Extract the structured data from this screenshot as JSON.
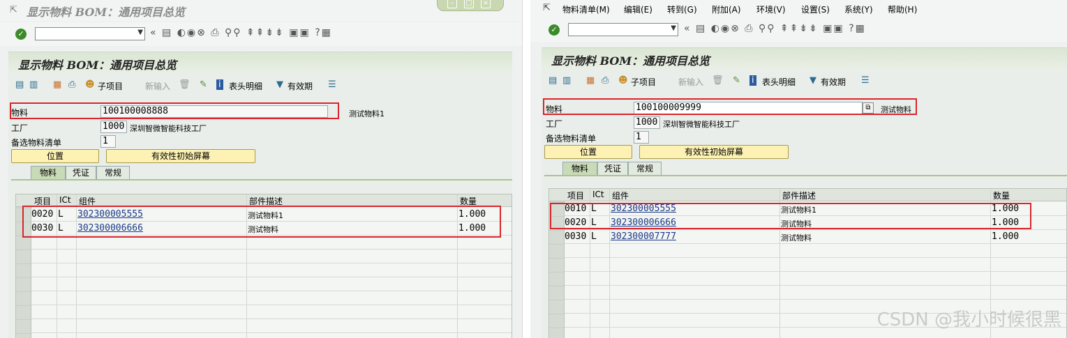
{
  "left": {
    "window_title": "显示物料 BOM：通用项目总览",
    "screen_title": "显示物料 BOM：通用项目总览",
    "toolbar": {
      "sub_item_label": "子项目",
      "new_entry_label": "新输入",
      "header_detail_label": "表头明细",
      "validity_label": "有效期"
    },
    "fields": {
      "material_label": "物料",
      "material_value": "100100008888",
      "material_desc": "测试物料1",
      "plant_label": "工厂",
      "plant_value": "1000",
      "plant_desc": "深圳智微智能科技工厂",
      "alt_bom_label": "备选物料清单",
      "alt_bom_value": "1"
    },
    "buttons": {
      "position": "位置",
      "validity_init": "有效性初始屏幕"
    },
    "tabs": [
      "物料",
      "凭证",
      "常规"
    ],
    "columns": [
      "项目",
      "ICt",
      "组件",
      "部件描述",
      "数量"
    ],
    "rows": [
      {
        "item": "0020",
        "ict": "L",
        "component": "302300005555",
        "desc": "测试物料1",
        "qty": "1.000"
      },
      {
        "item": "0030",
        "ict": "L",
        "component": "302300006666",
        "desc": "测试物料",
        "qty": "1.000"
      }
    ]
  },
  "right": {
    "menu": [
      "物料清单(M)",
      "编辑(E)",
      "转到(G)",
      "附加(A)",
      "环境(V)",
      "设置(S)",
      "系统(Y)",
      "帮助(H)"
    ],
    "screen_title": "显示物料 BOM：通用项目总览",
    "toolbar": {
      "sub_item_label": "子项目",
      "new_entry_label": "新输入",
      "header_detail_label": "表头明细",
      "validity_label": "有效期"
    },
    "fields": {
      "material_label": "物料",
      "material_value": "100100009999",
      "material_desc": "测试物料",
      "plant_label": "工厂",
      "plant_value": "1000",
      "plant_desc": "深圳智微智能科技工厂",
      "alt_bom_label": "备选物料清单",
      "alt_bom_value": "1"
    },
    "buttons": {
      "position": "位置",
      "validity_init": "有效性初始屏幕"
    },
    "tabs": [
      "物料",
      "凭证",
      "常规"
    ],
    "columns": [
      "项目",
      "ICt",
      "组件",
      "部件描述",
      "数量"
    ],
    "rows": [
      {
        "item": "0010",
        "ict": "L",
        "component": "302300005555",
        "desc": "测试物料1",
        "qty": "1.000"
      },
      {
        "item": "0020",
        "ict": "L",
        "component": "302300006666",
        "desc": "测试物料",
        "qty": "1.000"
      },
      {
        "item": "0030",
        "ict": "L",
        "component": "302300007777",
        "desc": "测试物料",
        "qty": "1.000"
      }
    ]
  },
  "watermark": "CSDN @我小时候很黑",
  "colors": {
    "highlight_box": "#d9252b",
    "button_bg": "#fdf2b3",
    "screen_title_bg": "#dbe6d3",
    "link": "#1a3a8a"
  }
}
